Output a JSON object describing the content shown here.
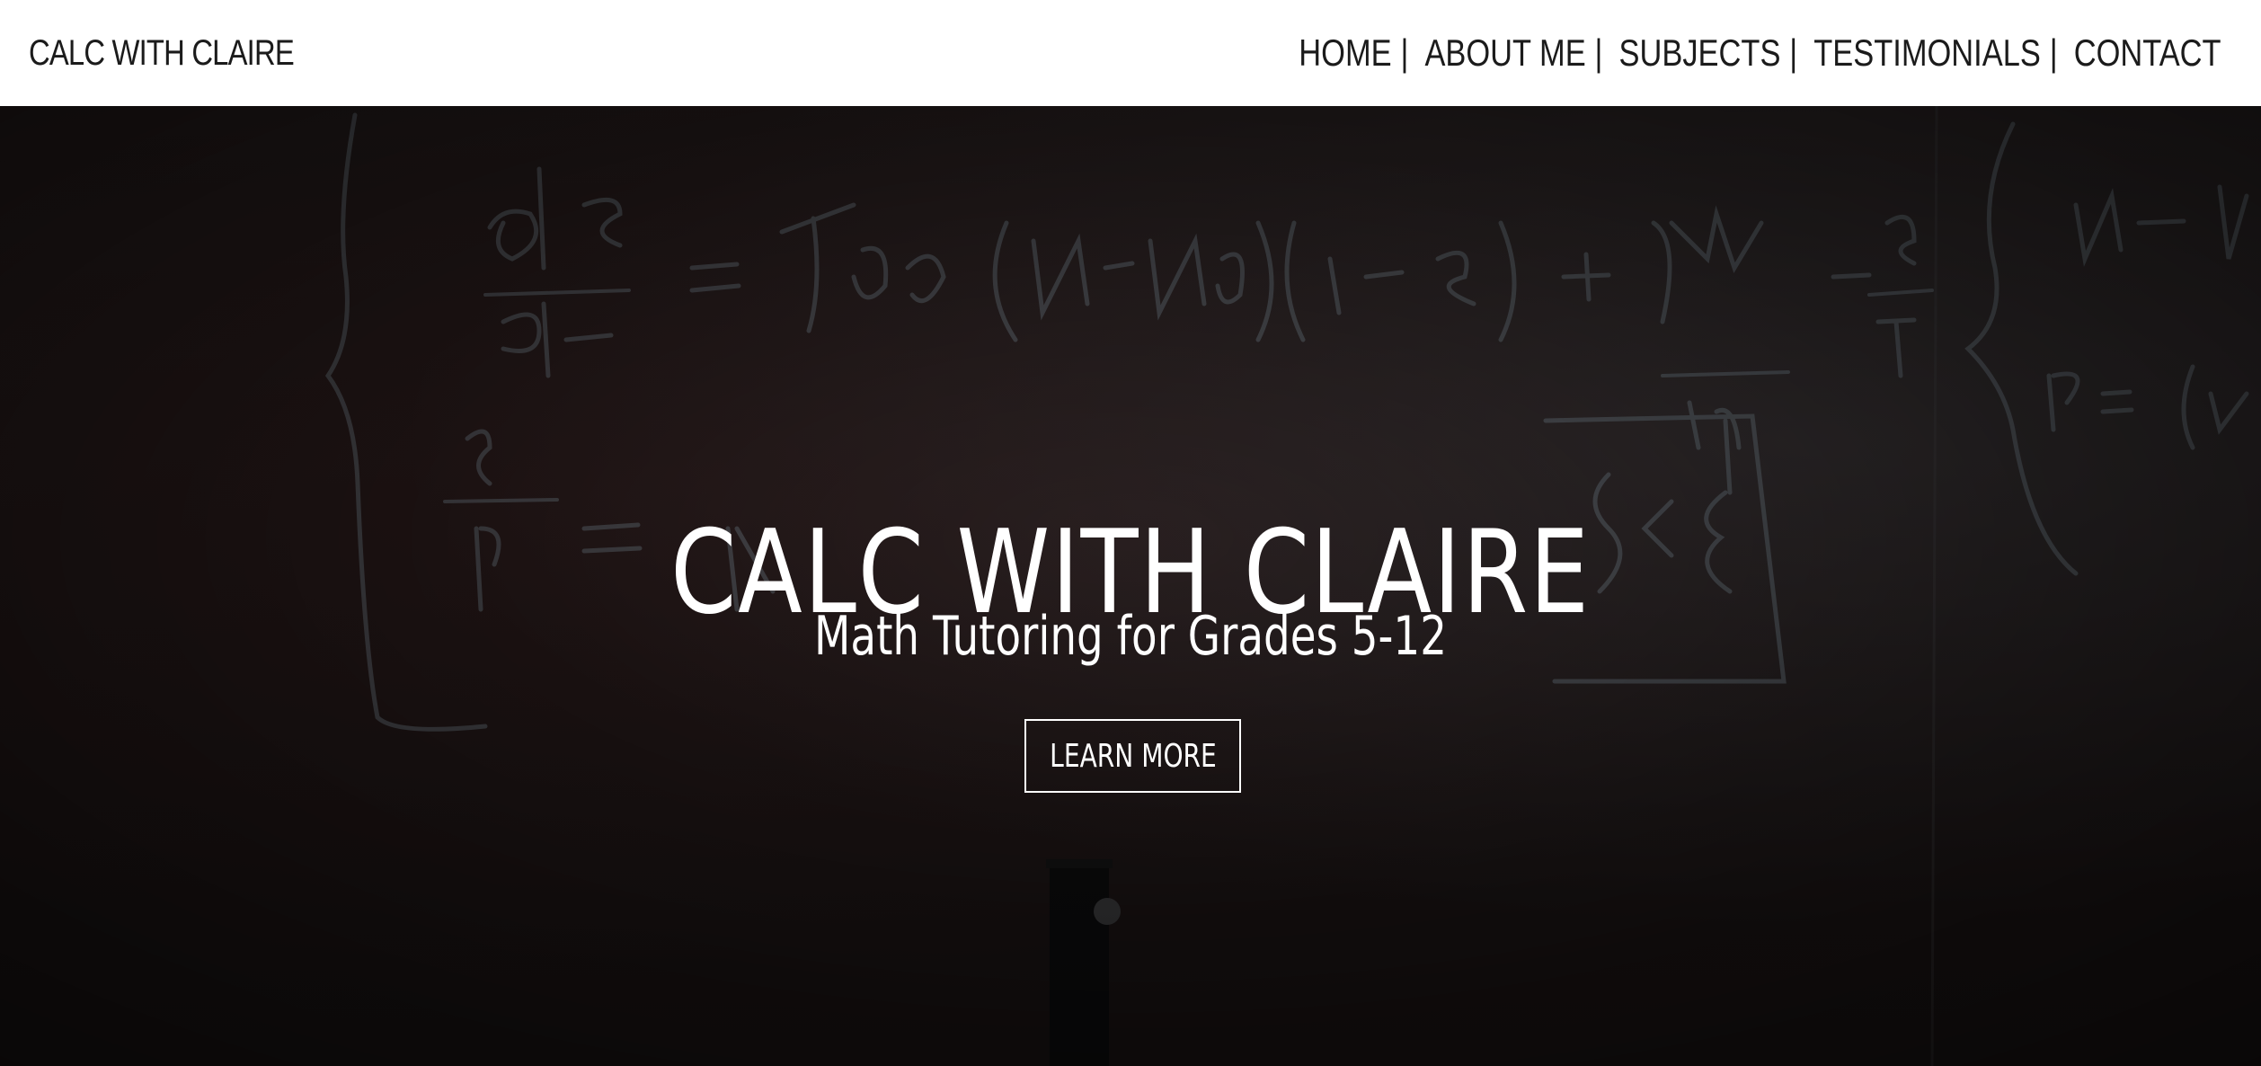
{
  "header": {
    "brand": "CALC WITH CLAIRE",
    "nav": [
      {
        "label": "HOME"
      },
      {
        "label": "ABOUT ME"
      },
      {
        "label": "SUBJECTS"
      },
      {
        "label": "TESTIMONIALS"
      },
      {
        "label": "CONTACT"
      }
    ],
    "separator": "|"
  },
  "hero": {
    "title": "CALC WITH CLAIRE",
    "subtitle": "Math Tutoring for Grades 5-12",
    "cta_label": "LEARN MORE",
    "background": "chalkboard-photo"
  },
  "colors": {
    "header_bg": "#ffffff",
    "header_text": "#1b1b1b",
    "hero_text": "#ffffff",
    "chalk": "#8a9aa6"
  }
}
